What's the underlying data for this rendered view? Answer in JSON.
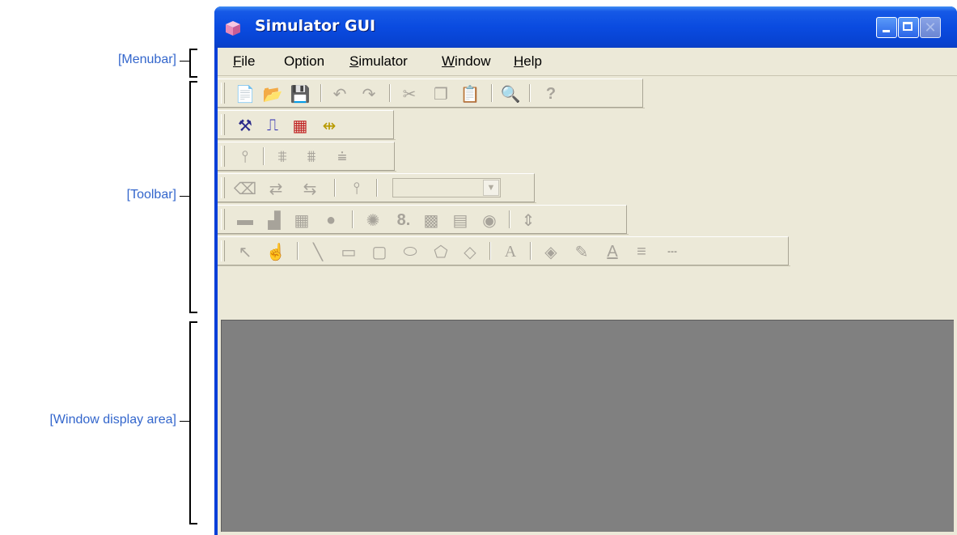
{
  "callouts": {
    "menubar": "[Menubar]",
    "toolbar": "[Toolbar]",
    "display": "[Window display area]"
  },
  "window": {
    "title": "Simulator GUI",
    "app_icon": "cube-icon"
  },
  "menubar": {
    "items": [
      {
        "mnemonic": "F",
        "rest": "ile"
      },
      {
        "mnemonic": "",
        "rest": "Option"
      },
      {
        "mnemonic": "S",
        "rest": "imulator"
      },
      {
        "mnemonic": "W",
        "rest": "indow"
      },
      {
        "mnemonic": "H",
        "rest": "elp"
      }
    ]
  },
  "toolbar": {
    "row1_icons": [
      "new-file-icon",
      "open-folder-icon",
      "save-icon",
      "undo-icon",
      "redo-icon",
      "cut-icon",
      "copy-icon",
      "paste-icon",
      "find-icon",
      "help-icon"
    ],
    "row2_icons": [
      "build-icon",
      "signal-icon",
      "wave-grid-icon",
      "connect-icon"
    ],
    "row3_icons": [
      "pin-icon",
      "pin-set-icon",
      "pin-toggle-icon",
      "pin-clear-icon"
    ],
    "row4_icons": [
      "eraser-icon",
      "pin-left-icon",
      "pin-right-icon",
      "pin-config-icon"
    ],
    "row4_combo_value": "",
    "row5_icons": [
      "bar-icon",
      "level-meter-icon",
      "grid-icon",
      "led-icon",
      "light-icon",
      "seven-seg-icon",
      "matrix-icon",
      "keypad-icon",
      "buzzer-icon",
      "adjust-icon"
    ],
    "row6_icons": [
      "select-arrow-icon",
      "hand-icon",
      "line-icon",
      "rectangle-icon",
      "rounded-rect-icon",
      "ellipse-icon",
      "polygon-icon",
      "diamond-icon",
      "text-icon",
      "fill-color-icon",
      "line-color-icon",
      "font-color-icon",
      "line-width-icon",
      "line-style-icon"
    ]
  },
  "colors": {
    "titlebar": "#0a4be0",
    "client": "#ece9d8",
    "display_area": "#808080",
    "callout_text": "#3366cc"
  }
}
